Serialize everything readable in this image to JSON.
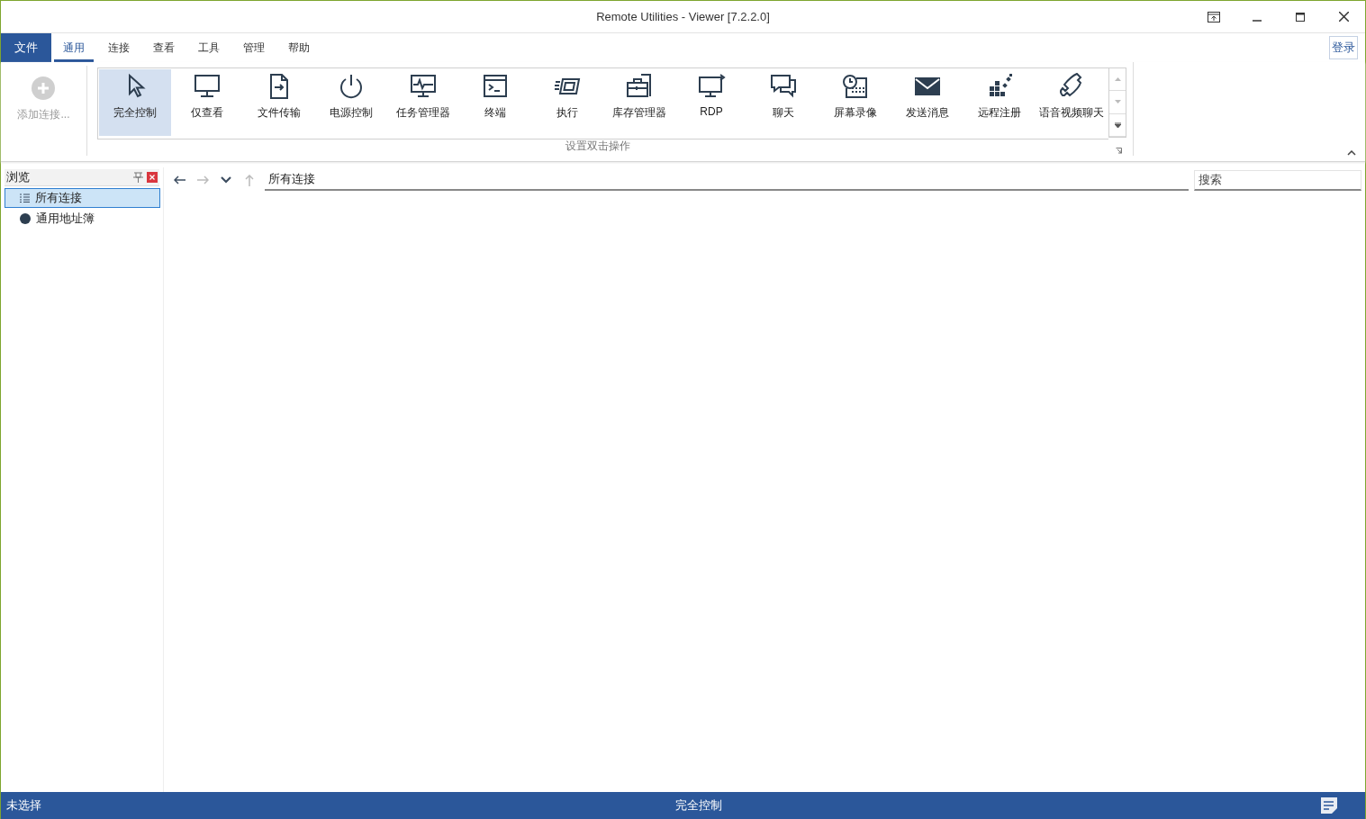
{
  "window": {
    "title": "Remote Utilities - Viewer [7.2.2.0]"
  },
  "menu_tabs": [
    {
      "label": "文件",
      "kind": "file",
      "selected": false
    },
    {
      "label": "通用",
      "kind": "tab",
      "selected": true
    },
    {
      "label": "连接",
      "kind": "tab",
      "selected": false
    },
    {
      "label": "查看",
      "kind": "tab",
      "selected": false
    },
    {
      "label": "工具",
      "kind": "tab",
      "selected": false
    },
    {
      "label": "管理",
      "kind": "tab",
      "selected": false
    },
    {
      "label": "帮助",
      "kind": "tab",
      "selected": false
    }
  ],
  "login_button": "登录",
  "add_connection": {
    "label": "添加连接...",
    "disabled": true
  },
  "ribbon": {
    "group_label": "设置双击操作",
    "tools": [
      {
        "label": "完全控制",
        "selected": true
      },
      {
        "label": "仅查看",
        "selected": false
      },
      {
        "label": "文件传输",
        "selected": false
      },
      {
        "label": "电源控制",
        "selected": false
      },
      {
        "label": "任务管理器",
        "selected": false
      },
      {
        "label": "终端",
        "selected": false
      },
      {
        "label": "执行",
        "selected": false
      },
      {
        "label": "库存管理器",
        "selected": false
      },
      {
        "label": "RDP",
        "selected": false
      },
      {
        "label": "聊天",
        "selected": false
      },
      {
        "label": "屏幕录像",
        "selected": false
      },
      {
        "label": "发送消息",
        "selected": false
      },
      {
        "label": "远程注册",
        "selected": false
      },
      {
        "label": "语音视频聊天",
        "selected": false
      }
    ]
  },
  "browse_panel": {
    "title": "浏览",
    "tree": [
      {
        "label": "所有连接",
        "kind": "list",
        "selected": true
      },
      {
        "label": "通用地址簿",
        "kind": "book",
        "selected": false
      }
    ]
  },
  "navigation": {
    "back_disabled": false,
    "forward_disabled": true,
    "up_disabled": true,
    "path": "所有连接"
  },
  "search": {
    "placeholder": "搜索"
  },
  "status_bar": {
    "left": "未选择",
    "center": "完全控制"
  }
}
